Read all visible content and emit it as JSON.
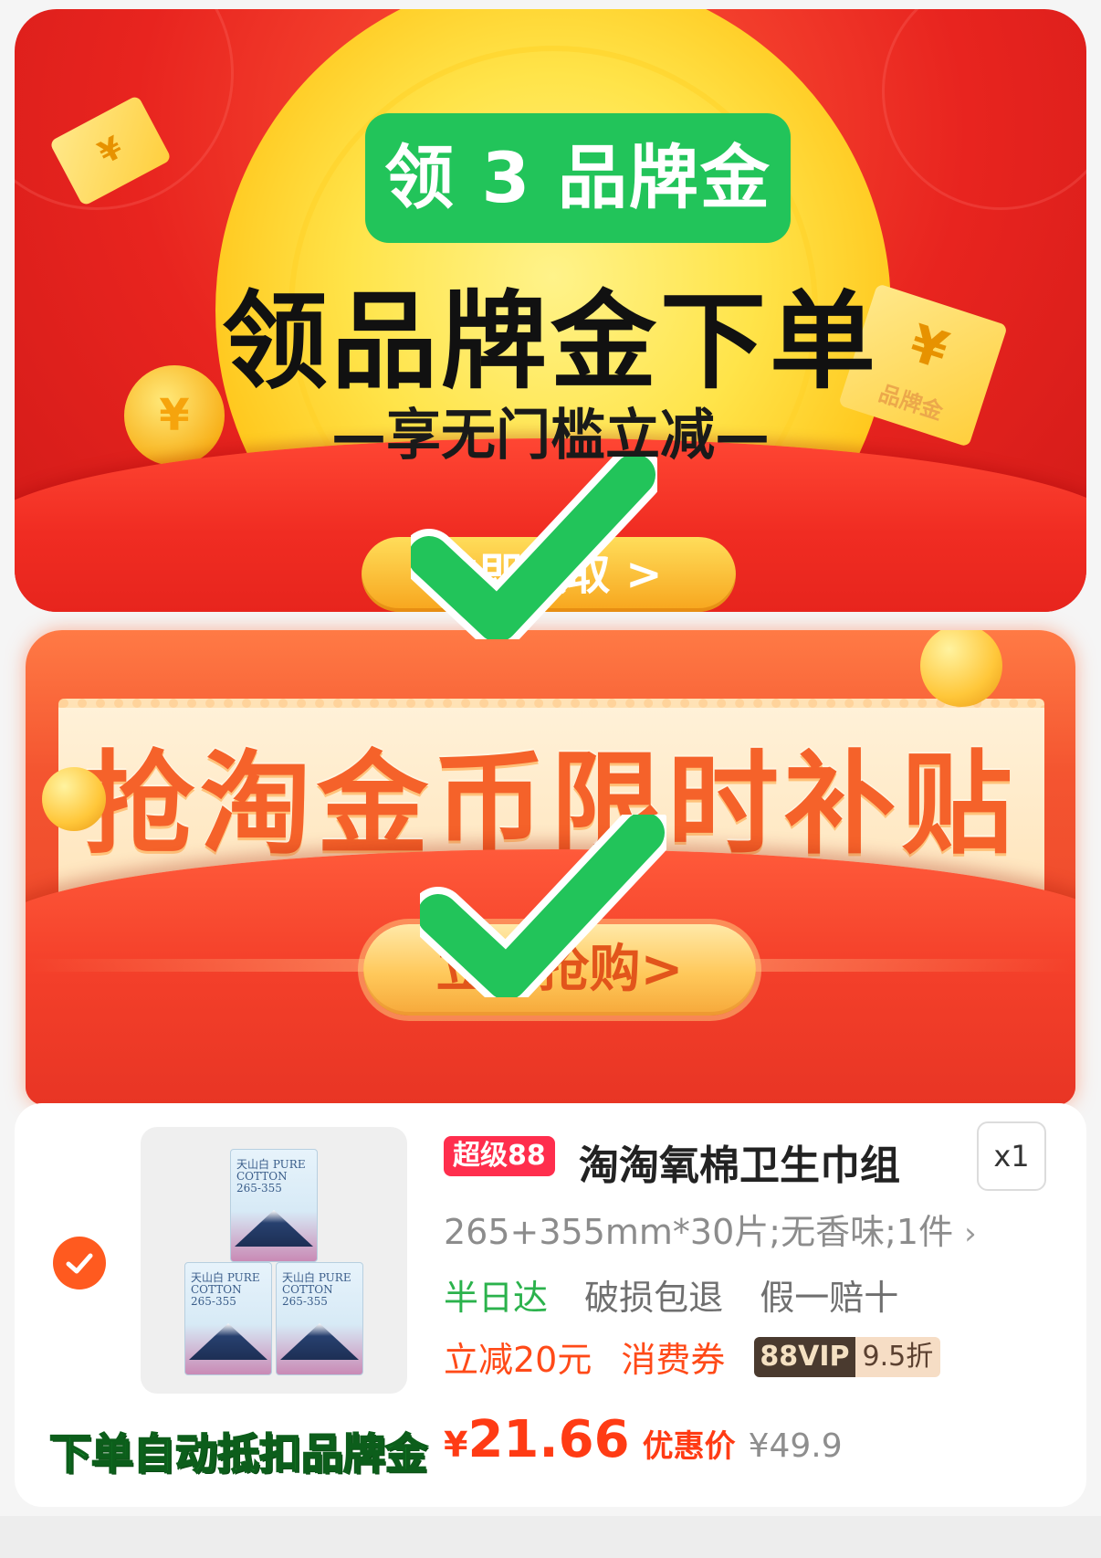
{
  "banner_top": {
    "tag": "领 3 品牌金",
    "title": "领品牌金下单",
    "subtitle": "—享无门槛立减—",
    "button_label": "立即领取 >",
    "ticket_symbol": "¥",
    "ticket_text": "品牌金"
  },
  "banner_mid": {
    "title": "抢淘金币限时补贴",
    "button_label": "立即抢购>"
  },
  "product": {
    "selected": true,
    "badge": "超级88",
    "title": "淘淘氧棉卫生巾组",
    "quantity": "x1",
    "spec": "265+355mm*30片;无香味;1件",
    "spec_chevron": "›",
    "services": [
      "半日达",
      "破损包退",
      "假一赔十"
    ],
    "promo_discount": "立减20元",
    "promo_coupon": "消费券",
    "vip_label": "88VIP",
    "vip_discount": "9.5折",
    "box_brand": "天山白 PURE COTTON 265-355",
    "currency": "¥",
    "price": "21.66",
    "price_label": "优惠价",
    "original_price": "¥49.9"
  },
  "annotation": {
    "deduct_note": "下单自动抵扣品牌金"
  },
  "colors": {
    "accent_red": "#e8241f",
    "check_green": "#22c45a",
    "price_orange": "#ff3b14"
  }
}
